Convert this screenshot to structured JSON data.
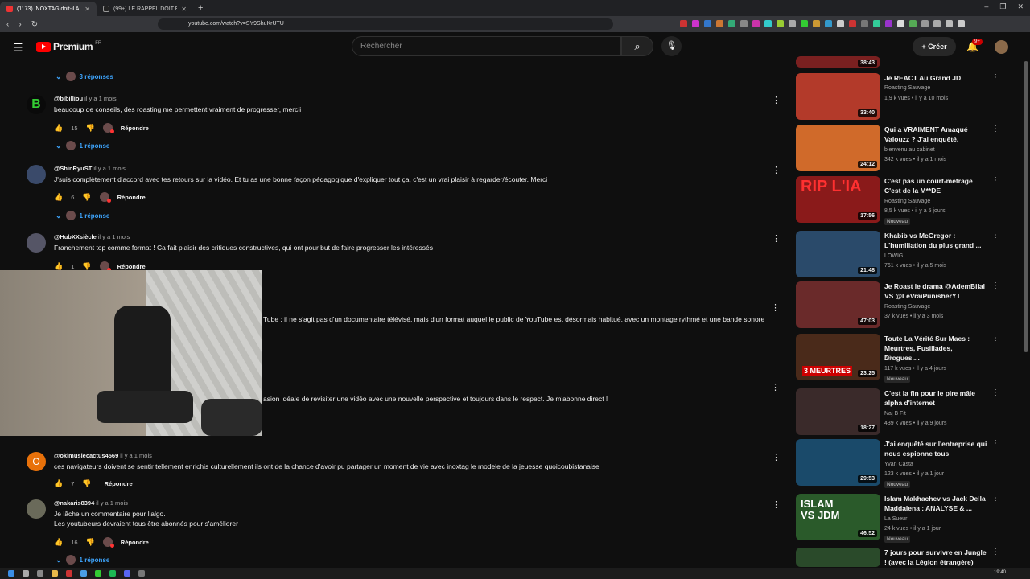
{
  "browser": {
    "tabs": [
      {
        "title": "(1173) INOXTAG doit-il ARRÊTER",
        "active": true
      },
      {
        "title": "(99+) LE RAPPEL DOIT ÊTRE FAIT AVE",
        "active": false
      }
    ],
    "url": "youtube.com/watch?v=SY9ShuKrUTU"
  },
  "header": {
    "logo_text": "Premium",
    "country": "FR",
    "search_placeholder": "Rechercher",
    "create_label": "Créer",
    "notif_count": "9+"
  },
  "comments": [
    {
      "replies_label": "3 réponses"
    },
    {
      "author": "@bibilliou",
      "time": "il y a 1 mois",
      "text": "beaucoup de conseils, des roasting me permettent vraiment de progresser, mercii",
      "likes": "15",
      "reply_label": "Répondre",
      "replies_label": "1 réponse",
      "avatar_color": "#0a0a0a",
      "avatar_letter": "B"
    },
    {
      "author": "@ShinRyuST",
      "time": "il y a 1 mois",
      "text": "J'suis complètement d'accord avec tes retours sur la vidéo. Et tu as une bonne façon pédagogique d'expliquer tout ça, c'est un vrai plaisir à regarder/écouter. Merci",
      "likes": "6",
      "reply_label": "Répondre",
      "replies_label": "1 réponse",
      "avatar_color": "#3a4a6a"
    },
    {
      "author": "@HubXXsiècle",
      "time": "il y a 1 mois",
      "text": "Franchement top comme format ! Ca fait plaisir des critiques constructives, qui ont pour but de faire progresser les intéressés",
      "likes": "1",
      "reply_label": "Répondre",
      "avatar_color": "#555566"
    },
    {
      "text": "Tube : il ne s'agit pas d'un documentaire télévisé, mais d'un format auquel le public de YouTube est désormais habitué, avec un montage rythmé et une bande sonore"
    },
    {
      "text": "asion idéale de revisiter une vidéo avec une nouvelle perspective et toujours dans le respect. Je m'abonne direct !"
    },
    {
      "author": "@oklmuslecactus4569",
      "time": "il y a 1 mois",
      "text": "ces navigateurs doivent se sentir tellement enrichis culturellement ils ont de la chance d'avoir pu partager un moment de vie avec inoxtag le modele de la jeuesse quoicoubistanaise",
      "likes": "7",
      "reply_label": "Répondre",
      "avatar_color": "#e8710a",
      "avatar_letter": "O"
    },
    {
      "author": "@nakaris8394",
      "time": "il y a 1 mois",
      "text_lines": [
        "Je lâche un commentaire pour l'algo.",
        "Les youtubeurs devraient tous être abonnés pour s'améliorer !"
      ],
      "likes": "16",
      "reply_label": "Répondre",
      "replies_label": "1 réponse",
      "avatar_color": "#6a6a5a"
    }
  ],
  "sidebar": {
    "videos": [
      {
        "duration": "38:43",
        "thumb_color": "#7a2020"
      },
      {
        "title": "Je REACT Au Grand JD",
        "channel": "Roasting Sauvage",
        "meta": "1,9 k vues • il y a 10 mois",
        "duration": "33:40",
        "thumb_color": "#b33a2a"
      },
      {
        "title": "Qui a VRAIMENT Amaqué Valouzz ? J'ai enquêté.",
        "channel": "bienvenu au cabinet",
        "meta": "342 k vues • il y a 1 mois",
        "duration": "24:12",
        "thumb_color": "#d06a2a"
      },
      {
        "title": "C'est pas un court-métrage C'est de la M**DE",
        "channel": "Roasting Sauvage",
        "meta": "8,5 k vues • il y a 5 jours",
        "badge": "Nouveau",
        "duration": "17:56",
        "thumb_color": "#8a1a1a",
        "thumb_text": "RIP L'IA"
      },
      {
        "title": "Khabib vs McGregor : L'humiliation du plus grand ...",
        "channel": "LOWIG",
        "meta": "761 k vues • il y a 5 mois",
        "duration": "21:48",
        "thumb_color": "#2a4a6a"
      },
      {
        "title": "Je Roast le drama @AdemBilal VS @LeVraiPunisherYT",
        "channel": "Roasting Sauvage",
        "meta": "37 k vues • il y a 3 mois",
        "duration": "47:03",
        "thumb_color": "#6a2a2a"
      },
      {
        "title": "Toute La Vérité Sur Maes : Meurtres, Fusillades, Drogues....",
        "channel": "Aflex",
        "meta": "117 k vues • il y a 4 jours",
        "badge": "Nouveau",
        "duration": "23:25",
        "thumb_color": "#4a2a1a",
        "thumb_text": "3 MEURTRES"
      },
      {
        "title": "C'est la fin pour le pire mâle alpha d'internet",
        "channel": "Naj B Fit",
        "meta": "439 k vues • il y a 9 jours",
        "duration": "18:27",
        "thumb_color": "#3a2a2a"
      },
      {
        "title": "J'ai enquêté sur l'entreprise qui nous espionne tous",
        "channel": "Yvan Casta",
        "meta": "123 k vues • il y a 1 jour",
        "badge": "Nouveau",
        "duration": "29:53",
        "thumb_color": "#1a4a6a"
      },
      {
        "title": "Islam Makhachev vs Jack Della Maddalena : ANALYSE & ...",
        "channel": "La Sueur",
        "meta": "24 k vues • il y a 1 jour",
        "badge": "Nouveau",
        "duration": "46:52",
        "thumb_color": "#2a5a2a",
        "thumb_text": "ISLAM VS JDM"
      },
      {
        "title": "7 jours pour survivre en Jungle ! (avec la Légion étrangère)",
        "thumb_color": "#2a4a2a"
      }
    ]
  },
  "taskbar": {
    "clock": "19:40"
  }
}
